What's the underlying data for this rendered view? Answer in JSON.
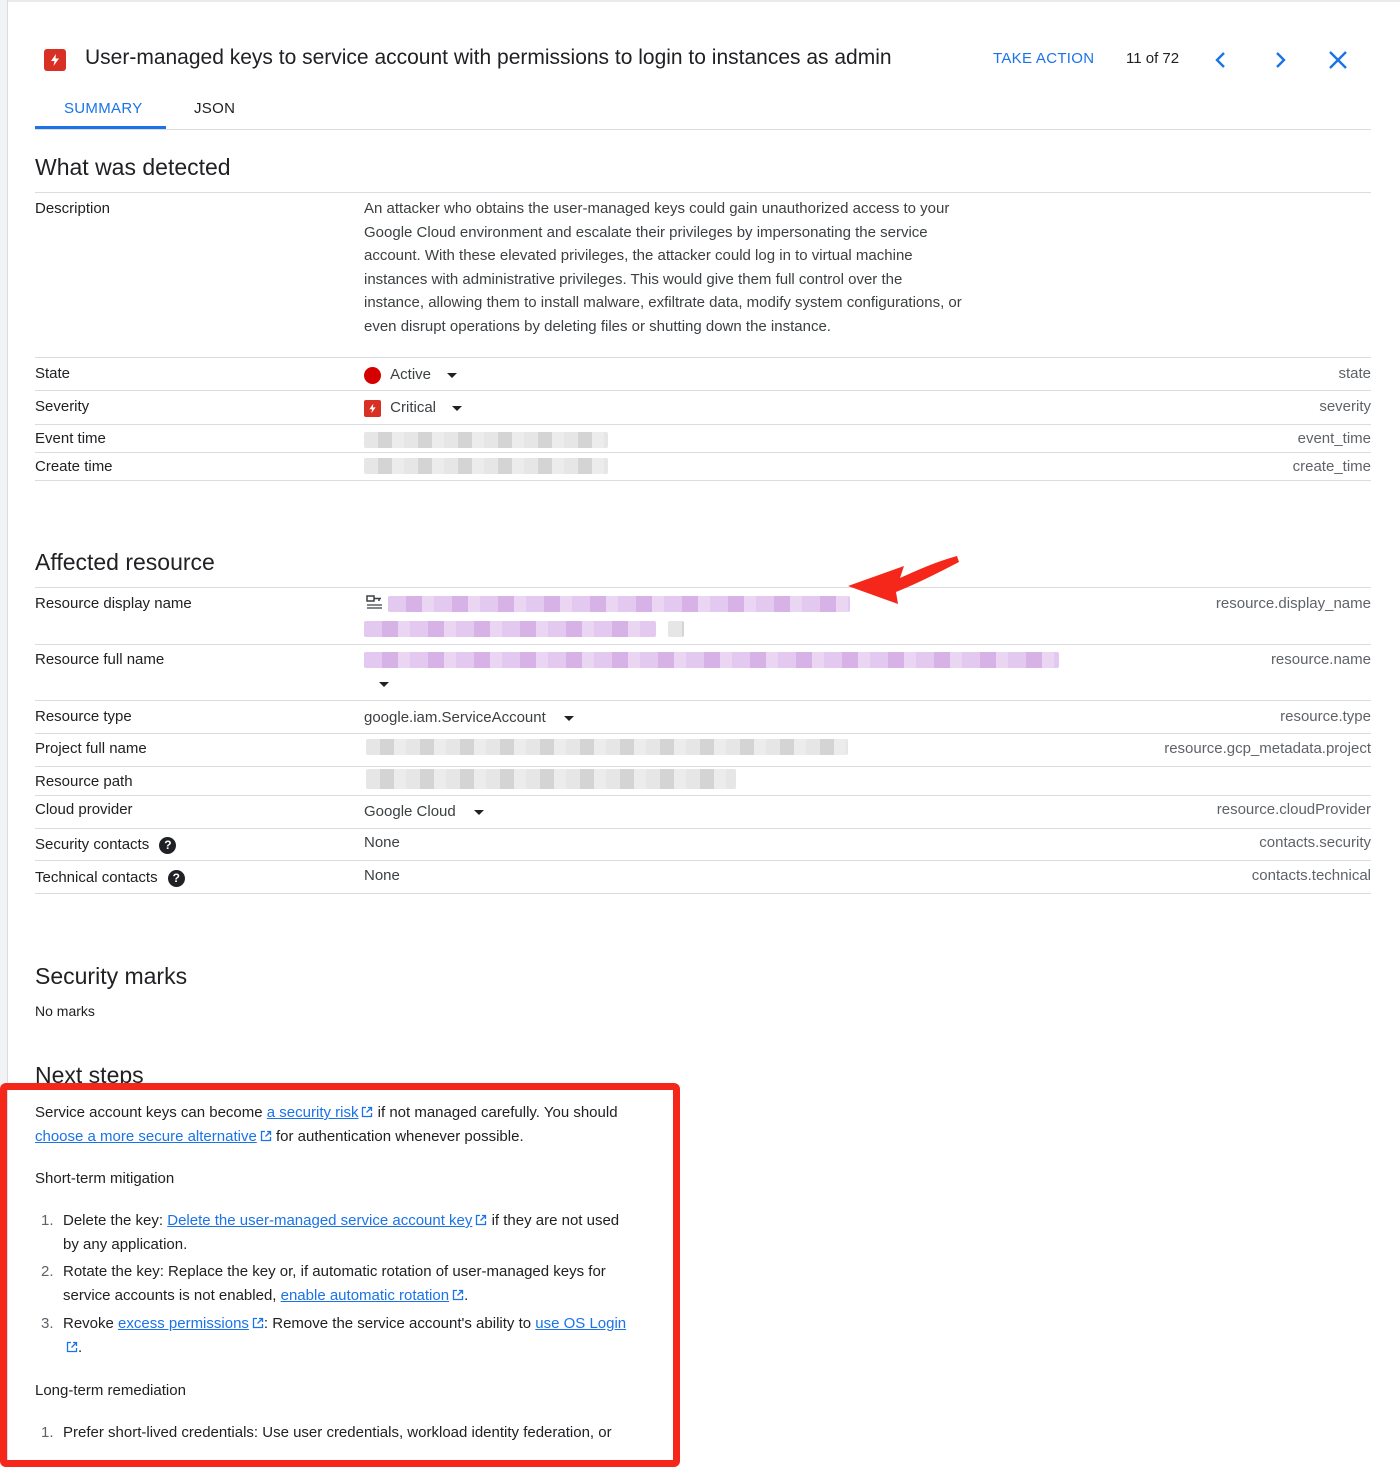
{
  "header": {
    "title": "User-managed keys to service account with permissions to login to instances as admin",
    "take_action": "TAKE ACTION",
    "counter": "11 of 72"
  },
  "tabs": [
    {
      "label": "SUMMARY",
      "active": true
    },
    {
      "label": "JSON",
      "active": false
    }
  ],
  "detected": {
    "heading": "What was detected",
    "description_label": "Description",
    "description": "An attacker who obtains the user-managed keys could gain unauthorized access to your Google Cloud environment and escalate their privileges by impersonating the service account. With these elevated privileges, the attacker could log in to virtual machine instances with administrative privileges. This would give them full control over the instance, allowing them to install malware, exfiltrate data, modify system configurations, or even disrupt operations by deleting files or shutting down the instance.",
    "rows": [
      {
        "label": "State",
        "value": "Active",
        "key": "state"
      },
      {
        "label": "Severity",
        "value": "Critical",
        "key": "severity"
      },
      {
        "label": "Event time",
        "value": "",
        "key": "event_time"
      },
      {
        "label": "Create time",
        "value": "",
        "key": "create_time"
      }
    ]
  },
  "affected": {
    "heading": "Affected resource",
    "rows": [
      {
        "label": "Resource display name",
        "value": "",
        "key": "resource.display_name"
      },
      {
        "label": "Resource full name",
        "value": "",
        "key": "resource.name"
      },
      {
        "label": "Resource type",
        "value": "google.iam.ServiceAccount",
        "key": "resource.type"
      },
      {
        "label": "Project full name",
        "value": "",
        "key": "resource.gcp_metadata.project"
      },
      {
        "label": "Resource path",
        "value": "",
        "key": ""
      },
      {
        "label": "Cloud provider",
        "value": "Google Cloud",
        "key": "resource.cloudProvider"
      },
      {
        "label": "Security contacts",
        "value": "None",
        "key": "contacts.security"
      },
      {
        "label": "Technical contacts",
        "value": "None",
        "key": "contacts.technical"
      }
    ]
  },
  "marks": {
    "heading": "Security marks",
    "value": "No marks"
  },
  "next_steps": {
    "heading": "Next steps",
    "intro_1": "Service account keys can become ",
    "intro_link_1": "a security risk",
    "intro_2": " if not managed carefully. You should",
    "intro_link_2": "choose a more secure alternative",
    "intro_3": " for authentication whenever possible.",
    "short_term_heading": "Short-term mitigation",
    "short_term": [
      {
        "num": "1.",
        "pre": "Delete the key: ",
        "link": "Delete the user-managed service account key",
        "post": " if they are not used by any application."
      },
      {
        "num": "2.",
        "pre": "Rotate the key: Replace the key or, if automatic rotation of user-managed keys for service accounts is not enabled, ",
        "link": "enable automatic rotation",
        "post": "."
      },
      {
        "num": "3.",
        "pre": "Revoke ",
        "link": "excess permissions",
        "mid": ": Remove the service account's ability to ",
        "link2": "use OS Login",
        "post": "."
      }
    ],
    "long_term_heading": "Long-term remediation",
    "long_term": [
      {
        "num": "1.",
        "text": "Prefer short-lived credentials: Use user credentials, workload identity federation, or"
      }
    ]
  },
  "icons": {
    "severity": "critical-bolt-icon",
    "state": "red-dot-icon",
    "prev": "chevron-left-icon",
    "next": "chevron-right-icon",
    "close": "close-icon",
    "help": "help-circle-icon",
    "external": "external-link-icon",
    "resource": "service-account-key-icon"
  },
  "colors": {
    "accent": "#1a73e8",
    "critical": "#d93025",
    "active": "#d50000",
    "annotation": "#f5271b"
  }
}
